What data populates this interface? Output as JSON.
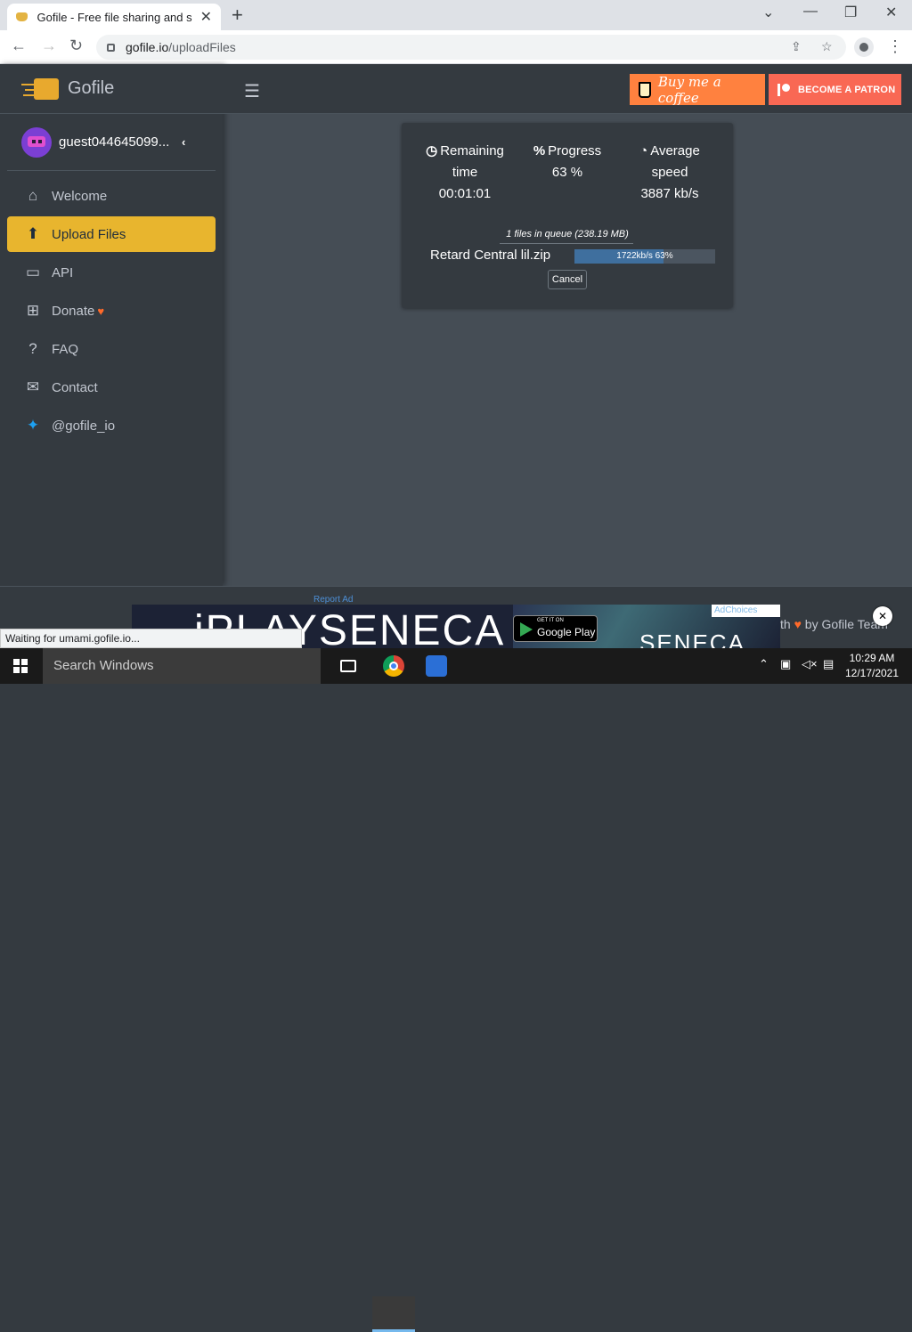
{
  "browser": {
    "tab_title": "Gofile - Free file sharing and s",
    "url_domain": "gofile.io",
    "url_path": "/uploadFiles"
  },
  "sidebar": {
    "brand": "Gofile",
    "username": "guest044645099...",
    "items": [
      {
        "label": "Welcome",
        "icon": "home-icon"
      },
      {
        "label": "Upload Files",
        "icon": "file-upload-icon",
        "active": true
      },
      {
        "label": "API",
        "icon": "laptop-code-icon"
      },
      {
        "label": "Donate",
        "icon": "gift-icon"
      },
      {
        "label": "FAQ",
        "icon": "question-circle-icon"
      },
      {
        "label": "Contact",
        "icon": "envelope-icon"
      },
      {
        "label": "@gofile_io",
        "icon": "twitter-icon"
      }
    ]
  },
  "topnav": {
    "coffee_label": "Buy me a coffee",
    "patron_label": "BECOME A PATRON"
  },
  "upload": {
    "remaining_label_1": "Remaining",
    "remaining_label_2": "time",
    "remaining_value": "00:01:01",
    "progress_label": "Progress",
    "progress_value": "63 %",
    "speed_label_1": "Average",
    "speed_label_2": "speed",
    "speed_value": "3887 kb/s",
    "queue_text": "1 files in queue (238.19 MB)",
    "file_name": "Retard Central lil.zip",
    "file_progress_text": "1722kb/s 63%",
    "file_progress_fraction": 0.63,
    "cancel_label": "Cancel"
  },
  "footer": {
    "credits_prefix": "th",
    "credits_suffix": "by Gofile Team"
  },
  "ad": {
    "report_label": "Report Ad",
    "brand_text": "iPLAYSENECA",
    "store_small": "GET IT ON",
    "store_big": "Google Play",
    "brand_text_2": "SENECA",
    "adchoices": "AdChoices"
  },
  "status_text": "Waiting for umami.gofile.io...",
  "taskbar": {
    "search_placeholder": "Search Windows",
    "time": "10:29 AM",
    "date": "12/17/2021"
  },
  "colors": {
    "accent": "#e8b52e",
    "sidebar_bg": "#343a40",
    "content_bg": "#454d55",
    "progress_fill": "#3f6f9e",
    "coffee": "#ff813f",
    "patron": "#f96854"
  }
}
